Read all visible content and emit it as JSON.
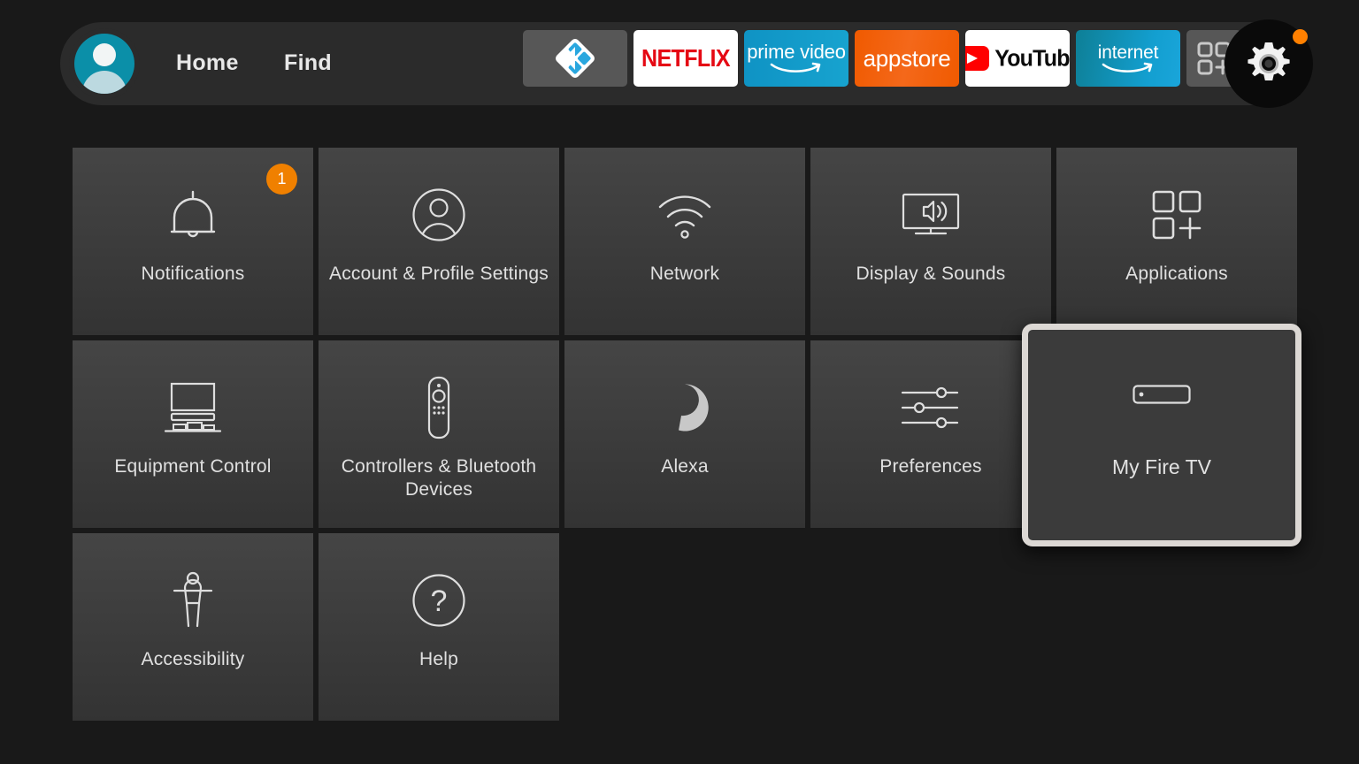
{
  "colors": {
    "background": "#191919",
    "topbar": "#2b2b2b",
    "tile_top": "#454545",
    "tile_bottom": "#333333",
    "accent_orange": "#f08000",
    "badge_dot": "#ff8000",
    "focus_border": "#dcd8d4",
    "netflix_red": "#e50914",
    "prime_blue": "#1399c6",
    "appstore_orange": "#f05a00",
    "internet_teal": "#0e7f96",
    "avatar_teal": "#0b8fa8",
    "text_primary": "#e0e0e0"
  },
  "topbar": {
    "avatar": {
      "name": "profile-avatar"
    },
    "nav": [
      {
        "label": "Home",
        "name": "nav-home"
      },
      {
        "label": "Find",
        "name": "nav-find"
      }
    ],
    "apps": [
      {
        "name": "kodi-app-icon",
        "label": "Kodi",
        "type": "kodi"
      },
      {
        "name": "netflix-app-icon",
        "label": "NETFLIX",
        "type": "netflix"
      },
      {
        "name": "prime-video-app-icon",
        "label": "prime video",
        "type": "prime"
      },
      {
        "name": "appstore-app-icon",
        "label": "appstore",
        "type": "appstore"
      },
      {
        "name": "youtube-app-icon",
        "label": "YouTube",
        "type": "youtube"
      },
      {
        "name": "internet-app-icon",
        "label": "internet",
        "type": "internet"
      },
      {
        "name": "apps-grid-add-icon",
        "label": "",
        "type": "apps"
      }
    ],
    "settings_button": {
      "name": "settings-gear-button",
      "icon": "gear-icon",
      "has_notification_dot": true
    }
  },
  "grid": {
    "rows": [
      [
        {
          "label": "Notifications",
          "icon": "bell-icon",
          "badge": "1"
        },
        {
          "label": "Account & Profile Settings",
          "icon": "person-circle-icon",
          "badge": null
        },
        {
          "label": "Network",
          "icon": "wifi-icon",
          "badge": null
        },
        {
          "label": "Display & Sounds",
          "icon": "tv-speaker-icon",
          "badge": null
        },
        {
          "label": "Applications",
          "icon": "apps-grid-icon",
          "badge": null
        }
      ],
      [
        {
          "label": "Equipment Control",
          "icon": "tv-soundbar-icon",
          "badge": null
        },
        {
          "label": "Controllers & Bluetooth Devices",
          "icon": "remote-control-icon",
          "badge": null
        },
        {
          "label": "Alexa",
          "icon": "alexa-ring-icon",
          "badge": null
        },
        {
          "label": "Preferences",
          "icon": "sliders-icon",
          "badge": null
        }
      ],
      [
        {
          "label": "Accessibility",
          "icon": "accessibility-person-icon",
          "badge": null
        },
        {
          "label": "Help",
          "icon": "question-circle-icon",
          "badge": null
        }
      ]
    ]
  },
  "focused_tile": {
    "label": "My Fire TV",
    "icon": "fire-tv-stick-icon",
    "focused": true
  }
}
